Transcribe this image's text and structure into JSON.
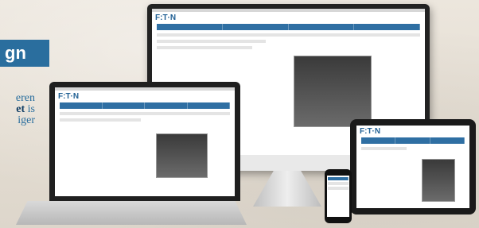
{
  "banner": {
    "text": "gn"
  },
  "side_text": {
    "line1": "eren",
    "line2_bold": "et",
    "line2_rest": " is",
    "line3": "iger"
  },
  "devices": {
    "monitor_logo": "F:T·N",
    "laptop_logo": "F:T·N",
    "tablet_logo": "F:T·N"
  },
  "colors": {
    "accent": "#2a6e9e",
    "accent_dark": "#123f66"
  }
}
